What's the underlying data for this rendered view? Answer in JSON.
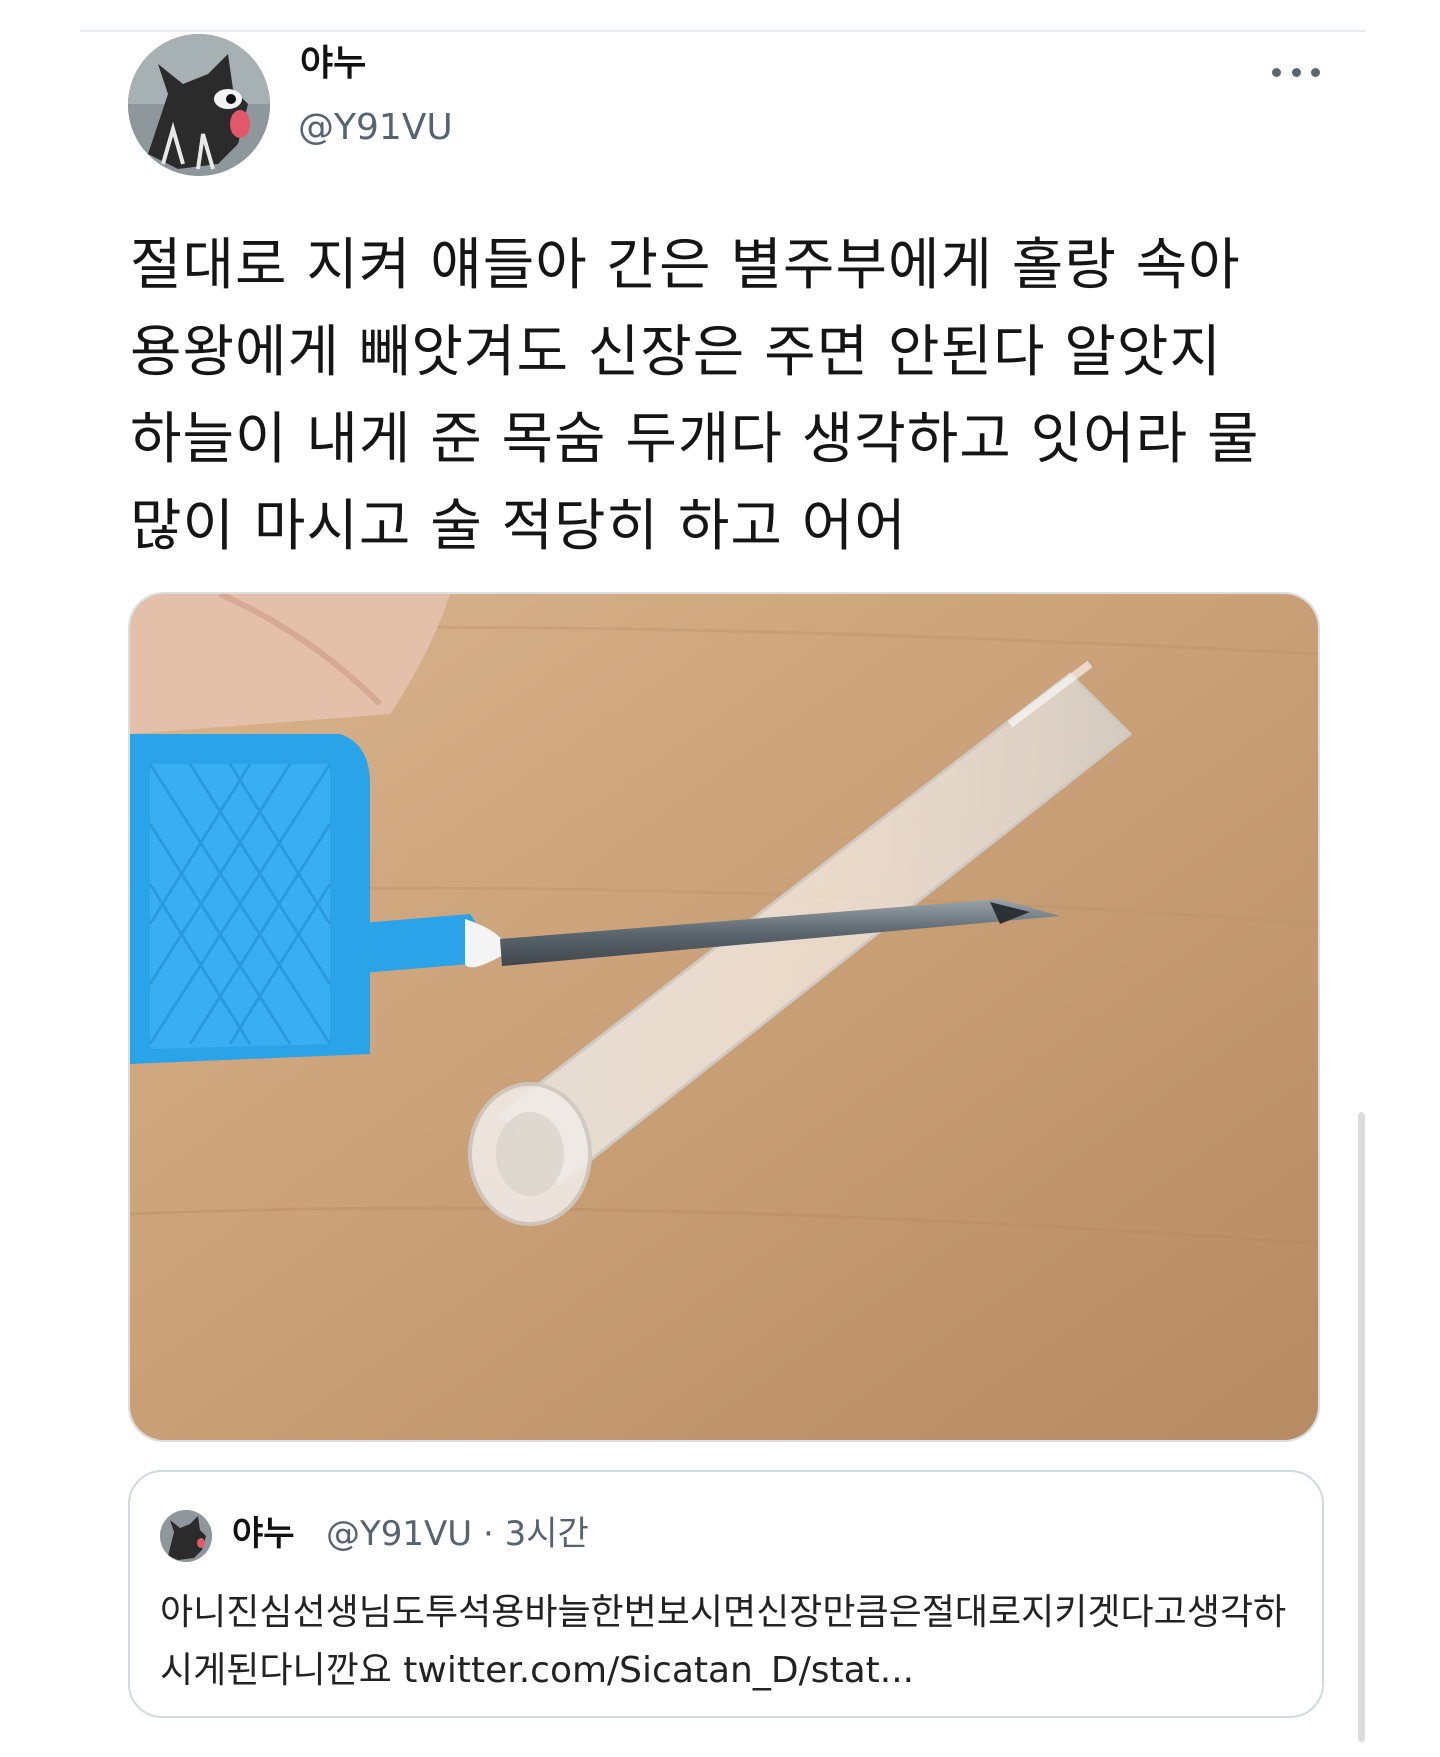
{
  "tweet": {
    "author_name": "야누",
    "author_handle": "@Y91VU",
    "more_icon": "more-horizontal-icon",
    "text": "절대로 지켜 얘들아 간은 별주부에게 홀랑 속아 용왕에게 빼앗겨도 신장은 주면 안된다 알앗지 하늘이 내게 준 목숨 두개다 생각하고 잇어라 물 많이 마시고 술 적당히 하고 어어",
    "media": {
      "colors": {
        "table": "#c9a17a",
        "lancet": "#2aa3e8",
        "needle": "#6f7a82"
      }
    }
  },
  "quoted_tweet": {
    "author_name": "야누",
    "author_handle_time": "@Y91VU · 3시간",
    "text": "아니진심선생님도투석용바늘한번보시면신장만큼은절대로지키겟다고생각하시게된다니깐요 twitter.com/Sicatan_D/stat..."
  }
}
